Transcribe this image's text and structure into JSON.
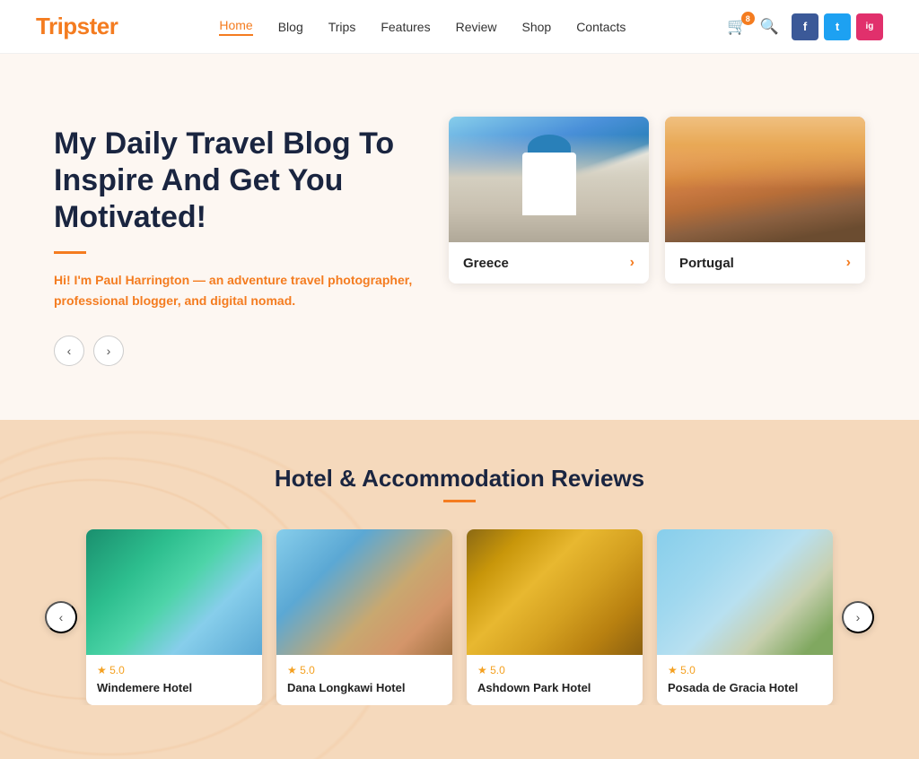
{
  "logo": {
    "part1": "Trip",
    "accent": "s",
    "part2": "ter"
  },
  "nav": {
    "items": [
      {
        "label": "Home",
        "active": true
      },
      {
        "label": "Blog",
        "active": false
      },
      {
        "label": "Trips",
        "active": false
      },
      {
        "label": "Features",
        "active": false
      },
      {
        "label": "Review",
        "active": false
      },
      {
        "label": "Shop",
        "active": false
      },
      {
        "label": "Contacts",
        "active": false
      }
    ]
  },
  "header": {
    "cart_badge": "8",
    "social": [
      {
        "label": "f",
        "class": "fb",
        "name": "facebook"
      },
      {
        "label": "t",
        "class": "tw",
        "name": "twitter"
      },
      {
        "label": "ig",
        "class": "ig",
        "name": "instagram"
      }
    ]
  },
  "hero": {
    "title": "My Daily Travel Blog To Inspire And Get You Motivated!",
    "intro": "Hi! I'm ",
    "author": "Paul Harrington",
    "bio": " — an adventure travel photographer, professional blogger, and digital nomad.",
    "prev_label": "‹",
    "next_label": "›"
  },
  "destinations": [
    {
      "label": "Greece",
      "arrow": "›"
    },
    {
      "label": "Portugal",
      "arrow": "›"
    }
  ],
  "hotel_section": {
    "title": "Hotel & Accommodation Reviews",
    "prev_label": "‹",
    "next_label": "›",
    "cards": [
      {
        "name": "Windemere Hotel",
        "stars": "★ 5.0",
        "img_class": "himg1"
      },
      {
        "name": "Dana Longkawi Hotel",
        "stars": "★ 5.0",
        "img_class": "himg2"
      },
      {
        "name": "Ashdown Park Hotel",
        "stars": "★ 5.0",
        "img_class": "himg3"
      },
      {
        "name": "Posada de Gracia Hotel",
        "stars": "★ 5.0",
        "img_class": "himg4"
      }
    ]
  }
}
